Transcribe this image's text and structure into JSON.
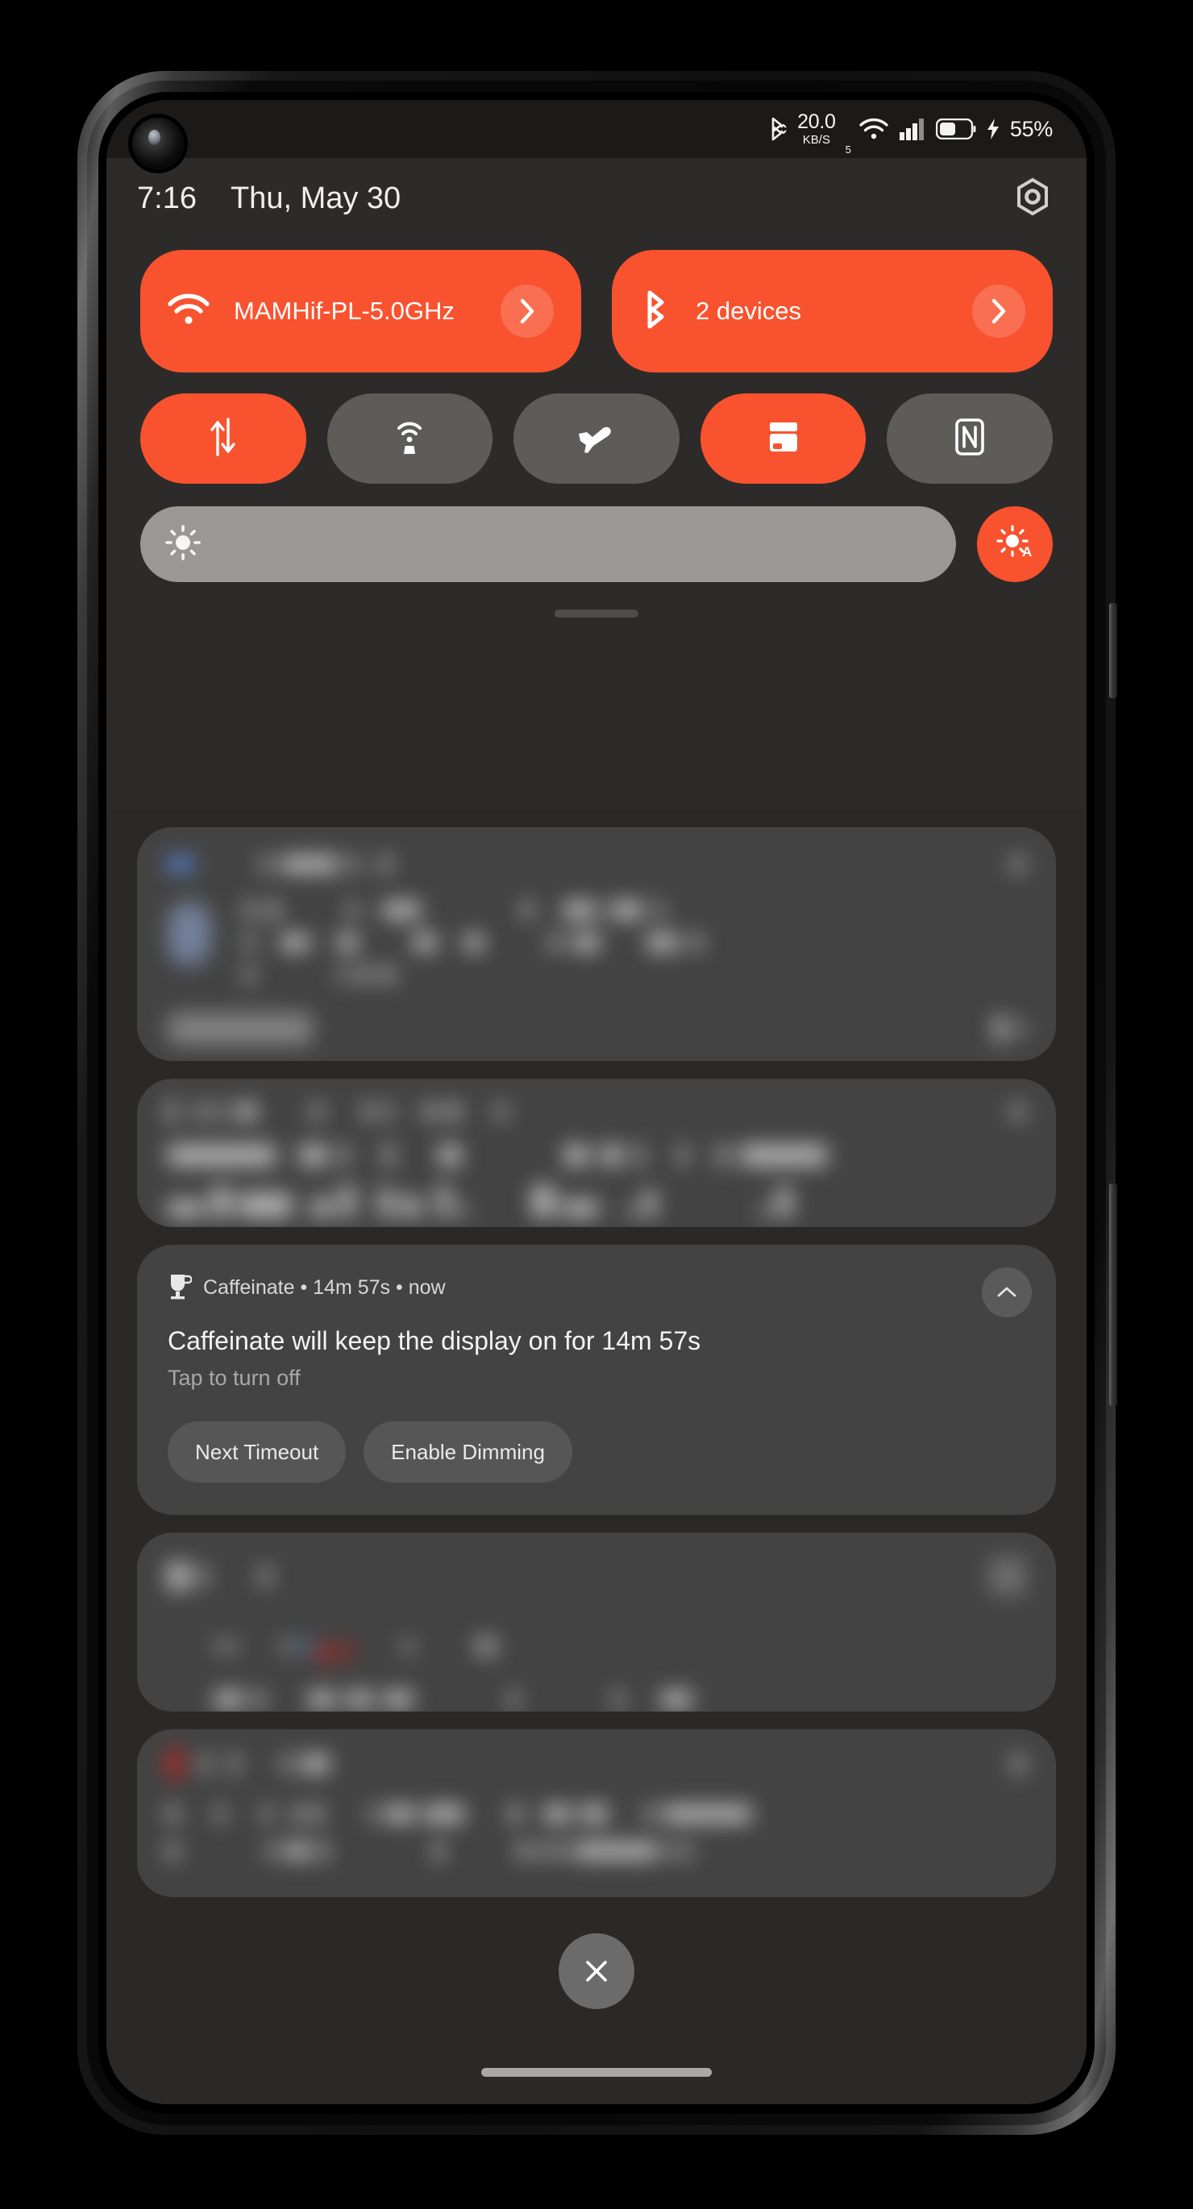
{
  "status_bar": {
    "bluetooth_icon": "bluetooth-icon",
    "net_speed_value": "20.0",
    "net_speed_unit": "KB/S",
    "wifi_icon": "wifi-icon",
    "wifi_generation": "5",
    "signal_icon": "cellular-signal-icon",
    "battery_icon": "battery-icon",
    "charging_icon": "charging-bolt-icon",
    "battery_percent": "55%"
  },
  "quick_settings": {
    "time": "7:16",
    "date": "Thu, May 30",
    "settings_icon": "settings-gear-icon",
    "accent_color": "#f9522f",
    "inactive_color": "#5e5c59",
    "big_tiles": [
      {
        "name": "wifi-tile",
        "icon": "wifi-icon",
        "label": "MAMHif-PL-5.0GHz",
        "active": true,
        "chevron": "chevron-right-icon"
      },
      {
        "name": "bluetooth-tile",
        "icon": "bluetooth-icon",
        "label": "2 devices",
        "active": true,
        "chevron": "chevron-right-icon"
      }
    ],
    "toggles": [
      {
        "name": "mobile-data-toggle",
        "icon": "mobile-data-arrows-icon",
        "active": true
      },
      {
        "name": "hotspot-toggle",
        "icon": "hotspot-icon",
        "active": false
      },
      {
        "name": "airplane-mode-toggle",
        "icon": "airplane-icon",
        "active": false
      },
      {
        "name": "wallet-toggle",
        "icon": "wallet-icon",
        "active": true
      },
      {
        "name": "nfc-toggle",
        "icon": "nfc-icon",
        "active": false
      }
    ],
    "brightness": {
      "name": "brightness-slider",
      "icon": "brightness-sun-icon",
      "level_percent": 100,
      "auto_button_icon": "auto-brightness-icon",
      "auto_active": true
    },
    "drag_handle": "drag-handle"
  },
  "notifications": [
    {
      "name": "notification-redacted-1",
      "redacted": true
    },
    {
      "name": "notification-redacted-2",
      "redacted": true
    },
    {
      "name": "notification-caffeinate",
      "redacted": false,
      "app_icon": "coffee-cup-icon",
      "app_name": "Caffeinate",
      "duration": "14m 57s",
      "time": "now",
      "header": "Caffeinate • 14m 57s • now",
      "title": "Caffeinate will keep the display on for 14m 57s",
      "subtitle": "Tap to turn off",
      "expand_icon": "chevron-up-icon",
      "actions": [
        {
          "name": "next-timeout-button",
          "label": "Next Timeout"
        },
        {
          "name": "enable-dimming-button",
          "label": "Enable Dimming"
        }
      ]
    },
    {
      "name": "notification-redacted-3",
      "redacted": true
    },
    {
      "name": "notification-redacted-4",
      "redacted": true
    }
  ],
  "shade": {
    "close_icon": "close-x-icon",
    "gesture_bar": "home-gesture-bar"
  }
}
